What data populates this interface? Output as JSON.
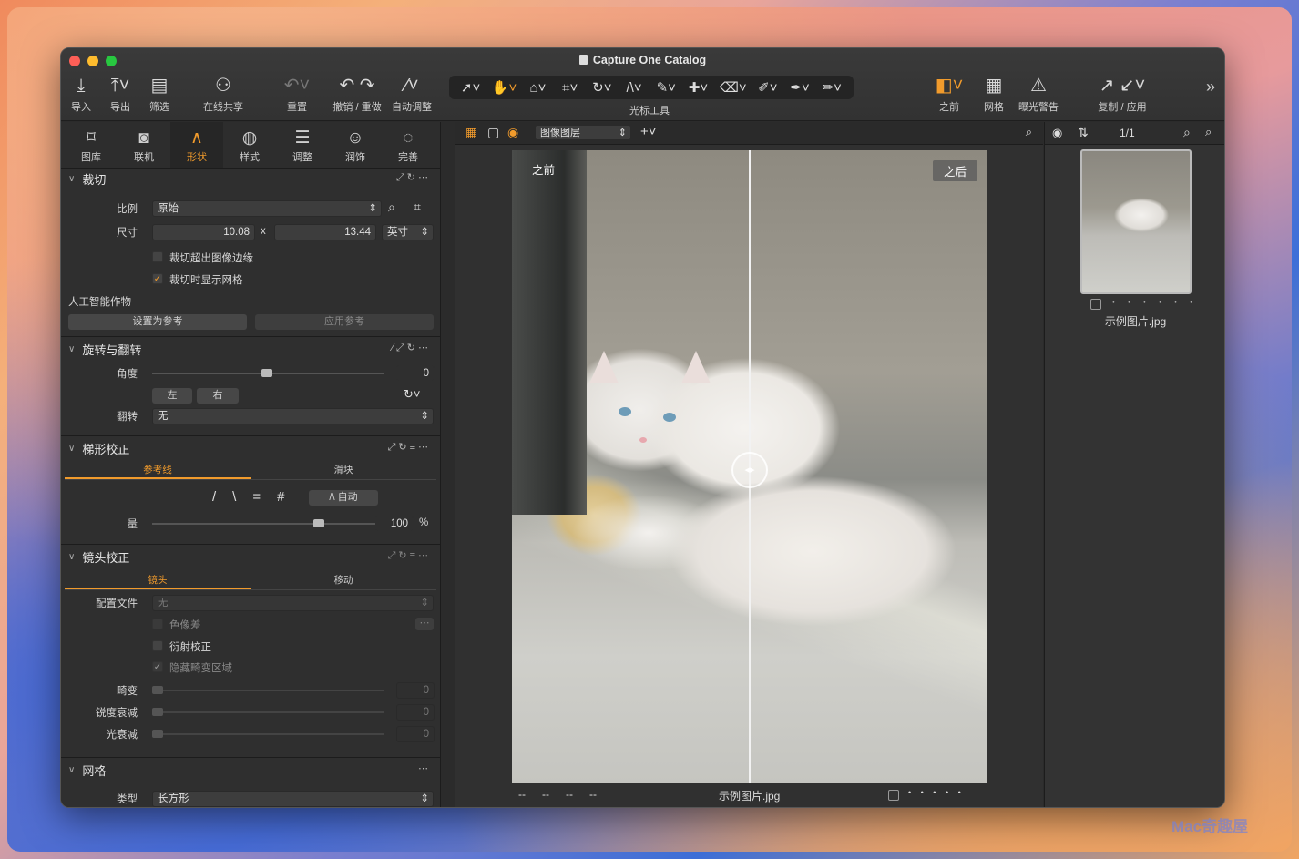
{
  "window": {
    "title": "Capture One Catalog"
  },
  "toolbar": {
    "import": "导入",
    "export": "导出",
    "filter": "筛选",
    "share": "在线共享",
    "reset": "重置",
    "undo_redo": "撤销 / 重做",
    "auto": "自动调整",
    "cursor_tools": "光标工具",
    "before": "之前",
    "grid": "网格",
    "exposure_warning": "曝光警告",
    "copy_apply": "复制 / 应用"
  },
  "tabs": [
    {
      "label": "图库",
      "icon": "folder-icon"
    },
    {
      "label": "联机",
      "icon": "camera-icon"
    },
    {
      "label": "形状",
      "icon": "shape-icon"
    },
    {
      "label": "样式",
      "icon": "style-icon"
    },
    {
      "label": "调整",
      "icon": "sliders-icon"
    },
    {
      "label": "润饰",
      "icon": "retouch-icon"
    },
    {
      "label": "完善",
      "icon": "refine-icon"
    }
  ],
  "crop": {
    "title": "裁切",
    "ratio_label": "比例",
    "ratio_value": "原始",
    "size_label": "尺寸",
    "width": "10.08",
    "x": "x",
    "height": "13.44",
    "unit": "英寸",
    "outside_label": "裁切超出图像边缘",
    "outside_checked": false,
    "grid_label": "裁切时显示网格",
    "grid_checked": true,
    "ai_label": "人工智能作物",
    "set_ref": "设置为参考",
    "apply_ref": "应用参考"
  },
  "rotate": {
    "title": "旋转与翻转",
    "angle_label": "角度",
    "angle_value": "0",
    "angle_fraction": 0.5,
    "left": "左",
    "right": "右",
    "flip_label": "翻转",
    "flip_value": "无"
  },
  "keystone": {
    "title": "梯形校正",
    "tab_guides": "参考线",
    "tab_sliders": "滑块",
    "auto": "自动",
    "amount_label": "量",
    "amount_value": "100",
    "amount_unit": "%",
    "amount_fraction": 0.72
  },
  "lens": {
    "title": "镜头校正",
    "tab_lens": "镜头",
    "tab_move": "移动",
    "profile_label": "配置文件",
    "profile_value": "无",
    "chromatic": "色像差",
    "diffraction": "衍射校正",
    "hide_distortion": "隐藏畸变区域",
    "distortion_label": "畸变",
    "distortion_value": "0",
    "sharpness_label": "锐度衰减",
    "sharpness_value": "0",
    "light_label": "光衰减",
    "light_value": "0"
  },
  "grid": {
    "title": "网格",
    "type_label": "类型",
    "type_value": "长方形"
  },
  "viewer": {
    "layer": "图像图层",
    "before_tag": "之前",
    "after_tag": "之后",
    "filename": "示例图片.jpg",
    "dashes": [
      "--",
      "--",
      "--",
      "--"
    ],
    "dots": "• • • • •"
  },
  "browser": {
    "count": "1/1",
    "filename": "示例图片.jpg",
    "dots": "• • • • • •"
  },
  "watermark": "Mac奇趣屋"
}
